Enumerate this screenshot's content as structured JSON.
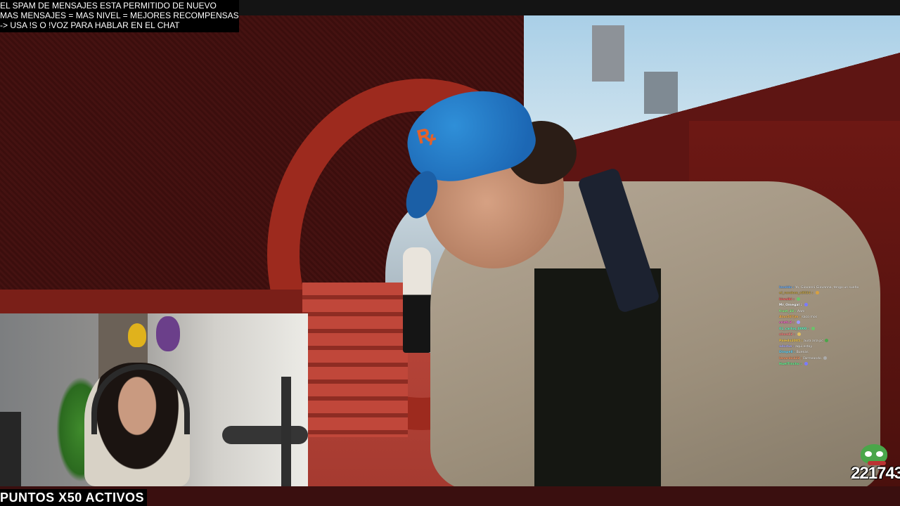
{
  "overlay_notice": {
    "lines": [
      "EL SPAM DE MENSAJES ESTA PERMITIDO DE NUEVO",
      "MAS MENSAJES = MAS NIVEL = MEJORES RECOMPENSAS",
      "-> USA !S  O !VOZ PARA HABLAR EN EL CHAT"
    ]
  },
  "chat": {
    "messages": [
      {
        "user": "Izzaldo :",
        "text": " Yo, Giovanni Giovanna, tengo un sueño",
        "color": "#6fb3ff"
      },
      {
        "user": "el_random_x8034 :",
        "text": " ",
        "color": "#c9a94a",
        "emote_color": "#d8a040"
      },
      {
        "user": "kiwaibi :",
        "text": " ",
        "color": "#ff6a6a",
        "emote_color": "#6ac26a"
      },
      {
        "user": "Mr_Omegal :",
        "text": " ",
        "color": "#ffffff",
        "emote_color": "#7a7aff"
      },
      {
        "user": "frost_18 :",
        "text": " Aam",
        "color": "#8aff8a"
      },
      {
        "user": "Alan587jm :",
        "text": " saco mos",
        "color": "#ffb84d"
      },
      {
        "user": "cristi.3 :",
        "text": " ",
        "color": "#ff6ad5",
        "emote_color": "#9a9aff"
      },
      {
        "user": "01_carlos_0000 :",
        "text": " ",
        "color": "#66ffcc",
        "emote_color": "#6ac26a"
      },
      {
        "user": "nhoa13 :",
        "text": " ",
        "color": "#ff8080",
        "emote_color": "#e0c060"
      },
      {
        "user": "Paledo2005 :",
        "text": " aura aria pc",
        "color": "#ffd24d",
        "emote_color": "#4aa64a"
      },
      {
        "user": "adorbe :",
        "text": " aqui estoy",
        "color": "#b0b0ff"
      },
      {
        "user": "Dimpell :",
        "text": " Buenas",
        "color": "#66d9ff"
      },
      {
        "user": "lenardo123 :",
        "text": " Farmeando ",
        "color": "#ff9966",
        "emote_color": "#aaaaaa"
      },
      {
        "user": "HuelTincho :",
        "text": " ",
        "color": "#66ff99",
        "emote_color": "#7a7aff"
      }
    ]
  },
  "counter": {
    "value": "221743",
    "emote": "pepe-emote"
  },
  "banner": {
    "points_label": "PUNTOS X50 ACTIVOS"
  },
  "colors": {
    "cap_blue": "#1c67b4",
    "wall_red": "#9d2a1e",
    "banner_bg": "#000000"
  }
}
